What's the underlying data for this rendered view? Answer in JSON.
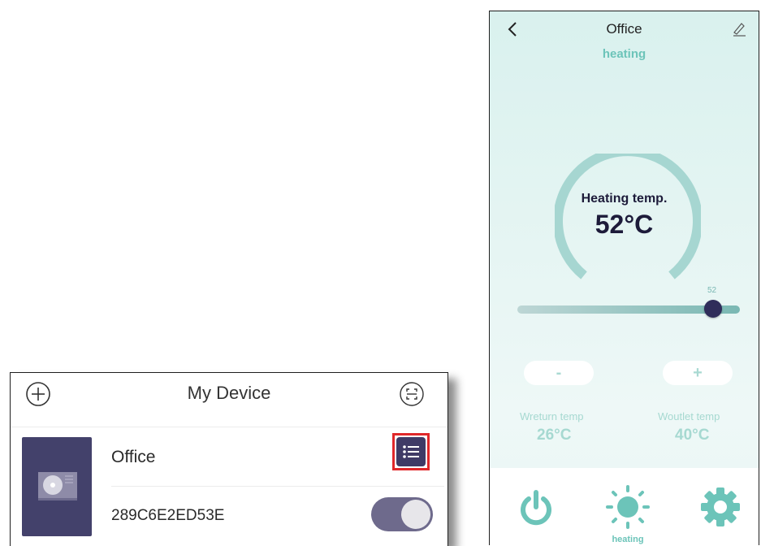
{
  "left_panel": {
    "title": "My Device",
    "device": {
      "name": "Office",
      "id": "289C6E2ED53E",
      "power_toggle_on": true
    }
  },
  "right_panel": {
    "title": "Office",
    "mode": "heating",
    "gauge": {
      "label": "Heating temp.",
      "value": "52°C"
    },
    "slider": {
      "value_label": "52",
      "value": 52
    },
    "buttons": {
      "minus": "-",
      "plus": "+"
    },
    "wreturn": {
      "label": "Wreturn temp",
      "value": "26°C"
    },
    "woutlet": {
      "label": "Woutlet temp",
      "value": "40°C"
    },
    "bottom_nav": {
      "power_icon": "power-icon",
      "heat_icon": "sun-icon",
      "heat_label": "heating",
      "settings_icon": "gear-icon"
    }
  },
  "colors": {
    "accent": "#6cc4b9",
    "device_purple": "#3f3b66",
    "highlight_red": "#e0282a",
    "dark_text": "#1d1b3a"
  }
}
